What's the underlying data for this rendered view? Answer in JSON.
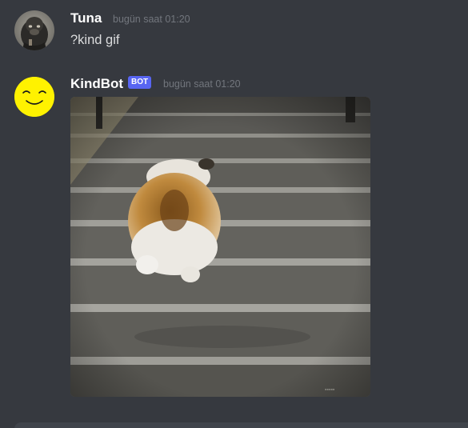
{
  "messages": [
    {
      "author": "Tuna",
      "timestamp": "bugün saat 01:20",
      "content": "?kind gif",
      "avatar_icon": "gorilla-avatar"
    },
    {
      "author": "KindBot",
      "bot_tag": "BOT",
      "timestamp": "bugün saat 01:20",
      "avatar_icon": "smiley-face-avatar",
      "attachment": {
        "type": "gif",
        "subject": "corgi-walking-up-stairs"
      }
    }
  ],
  "colors": {
    "background": "#36393f",
    "username": "#ffffff",
    "timestamp": "#72767d",
    "message_text": "#dcddde",
    "bot_tag": "#5865f2",
    "smiley_yellow": "#fff200"
  }
}
